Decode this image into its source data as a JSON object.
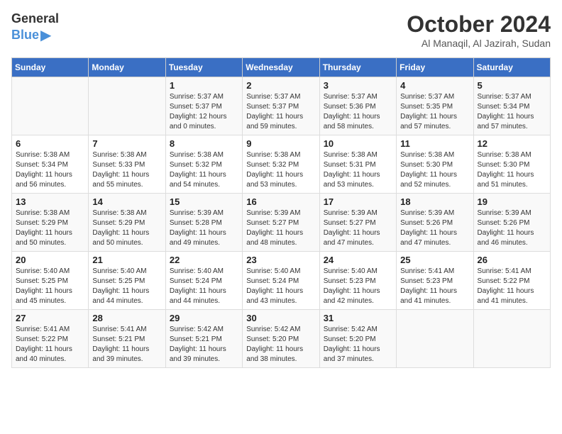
{
  "logo": {
    "general": "General",
    "blue": "Blue"
  },
  "header": {
    "month": "October 2024",
    "location": "Al Manaqil, Al Jazirah, Sudan"
  },
  "weekdays": [
    "Sunday",
    "Monday",
    "Tuesday",
    "Wednesday",
    "Thursday",
    "Friday",
    "Saturday"
  ],
  "weeks": [
    [
      {
        "day": "",
        "sunrise": "",
        "sunset": "",
        "daylight": ""
      },
      {
        "day": "",
        "sunrise": "",
        "sunset": "",
        "daylight": ""
      },
      {
        "day": "1",
        "sunrise": "Sunrise: 5:37 AM",
        "sunset": "Sunset: 5:37 PM",
        "daylight": "Daylight: 12 hours and 0 minutes."
      },
      {
        "day": "2",
        "sunrise": "Sunrise: 5:37 AM",
        "sunset": "Sunset: 5:37 PM",
        "daylight": "Daylight: 11 hours and 59 minutes."
      },
      {
        "day": "3",
        "sunrise": "Sunrise: 5:37 AM",
        "sunset": "Sunset: 5:36 PM",
        "daylight": "Daylight: 11 hours and 58 minutes."
      },
      {
        "day": "4",
        "sunrise": "Sunrise: 5:37 AM",
        "sunset": "Sunset: 5:35 PM",
        "daylight": "Daylight: 11 hours and 57 minutes."
      },
      {
        "day": "5",
        "sunrise": "Sunrise: 5:37 AM",
        "sunset": "Sunset: 5:34 PM",
        "daylight": "Daylight: 11 hours and 57 minutes."
      }
    ],
    [
      {
        "day": "6",
        "sunrise": "Sunrise: 5:38 AM",
        "sunset": "Sunset: 5:34 PM",
        "daylight": "Daylight: 11 hours and 56 minutes."
      },
      {
        "day": "7",
        "sunrise": "Sunrise: 5:38 AM",
        "sunset": "Sunset: 5:33 PM",
        "daylight": "Daylight: 11 hours and 55 minutes."
      },
      {
        "day": "8",
        "sunrise": "Sunrise: 5:38 AM",
        "sunset": "Sunset: 5:32 PM",
        "daylight": "Daylight: 11 hours and 54 minutes."
      },
      {
        "day": "9",
        "sunrise": "Sunrise: 5:38 AM",
        "sunset": "Sunset: 5:32 PM",
        "daylight": "Daylight: 11 hours and 53 minutes."
      },
      {
        "day": "10",
        "sunrise": "Sunrise: 5:38 AM",
        "sunset": "Sunset: 5:31 PM",
        "daylight": "Daylight: 11 hours and 53 minutes."
      },
      {
        "day": "11",
        "sunrise": "Sunrise: 5:38 AM",
        "sunset": "Sunset: 5:30 PM",
        "daylight": "Daylight: 11 hours and 52 minutes."
      },
      {
        "day": "12",
        "sunrise": "Sunrise: 5:38 AM",
        "sunset": "Sunset: 5:30 PM",
        "daylight": "Daylight: 11 hours and 51 minutes."
      }
    ],
    [
      {
        "day": "13",
        "sunrise": "Sunrise: 5:38 AM",
        "sunset": "Sunset: 5:29 PM",
        "daylight": "Daylight: 11 hours and 50 minutes."
      },
      {
        "day": "14",
        "sunrise": "Sunrise: 5:38 AM",
        "sunset": "Sunset: 5:29 PM",
        "daylight": "Daylight: 11 hours and 50 minutes."
      },
      {
        "day": "15",
        "sunrise": "Sunrise: 5:39 AM",
        "sunset": "Sunset: 5:28 PM",
        "daylight": "Daylight: 11 hours and 49 minutes."
      },
      {
        "day": "16",
        "sunrise": "Sunrise: 5:39 AM",
        "sunset": "Sunset: 5:27 PM",
        "daylight": "Daylight: 11 hours and 48 minutes."
      },
      {
        "day": "17",
        "sunrise": "Sunrise: 5:39 AM",
        "sunset": "Sunset: 5:27 PM",
        "daylight": "Daylight: 11 hours and 47 minutes."
      },
      {
        "day": "18",
        "sunrise": "Sunrise: 5:39 AM",
        "sunset": "Sunset: 5:26 PM",
        "daylight": "Daylight: 11 hours and 47 minutes."
      },
      {
        "day": "19",
        "sunrise": "Sunrise: 5:39 AM",
        "sunset": "Sunset: 5:26 PM",
        "daylight": "Daylight: 11 hours and 46 minutes."
      }
    ],
    [
      {
        "day": "20",
        "sunrise": "Sunrise: 5:40 AM",
        "sunset": "Sunset: 5:25 PM",
        "daylight": "Daylight: 11 hours and 45 minutes."
      },
      {
        "day": "21",
        "sunrise": "Sunrise: 5:40 AM",
        "sunset": "Sunset: 5:25 PM",
        "daylight": "Daylight: 11 hours and 44 minutes."
      },
      {
        "day": "22",
        "sunrise": "Sunrise: 5:40 AM",
        "sunset": "Sunset: 5:24 PM",
        "daylight": "Daylight: 11 hours and 44 minutes."
      },
      {
        "day": "23",
        "sunrise": "Sunrise: 5:40 AM",
        "sunset": "Sunset: 5:24 PM",
        "daylight": "Daylight: 11 hours and 43 minutes."
      },
      {
        "day": "24",
        "sunrise": "Sunrise: 5:40 AM",
        "sunset": "Sunset: 5:23 PM",
        "daylight": "Daylight: 11 hours and 42 minutes."
      },
      {
        "day": "25",
        "sunrise": "Sunrise: 5:41 AM",
        "sunset": "Sunset: 5:23 PM",
        "daylight": "Daylight: 11 hours and 41 minutes."
      },
      {
        "day": "26",
        "sunrise": "Sunrise: 5:41 AM",
        "sunset": "Sunset: 5:22 PM",
        "daylight": "Daylight: 11 hours and 41 minutes."
      }
    ],
    [
      {
        "day": "27",
        "sunrise": "Sunrise: 5:41 AM",
        "sunset": "Sunset: 5:22 PM",
        "daylight": "Daylight: 11 hours and 40 minutes."
      },
      {
        "day": "28",
        "sunrise": "Sunrise: 5:41 AM",
        "sunset": "Sunset: 5:21 PM",
        "daylight": "Daylight: 11 hours and 39 minutes."
      },
      {
        "day": "29",
        "sunrise": "Sunrise: 5:42 AM",
        "sunset": "Sunset: 5:21 PM",
        "daylight": "Daylight: 11 hours and 39 minutes."
      },
      {
        "day": "30",
        "sunrise": "Sunrise: 5:42 AM",
        "sunset": "Sunset: 5:20 PM",
        "daylight": "Daylight: 11 hours and 38 minutes."
      },
      {
        "day": "31",
        "sunrise": "Sunrise: 5:42 AM",
        "sunset": "Sunset: 5:20 PM",
        "daylight": "Daylight: 11 hours and 37 minutes."
      },
      {
        "day": "",
        "sunrise": "",
        "sunset": "",
        "daylight": ""
      },
      {
        "day": "",
        "sunrise": "",
        "sunset": "",
        "daylight": ""
      }
    ]
  ]
}
